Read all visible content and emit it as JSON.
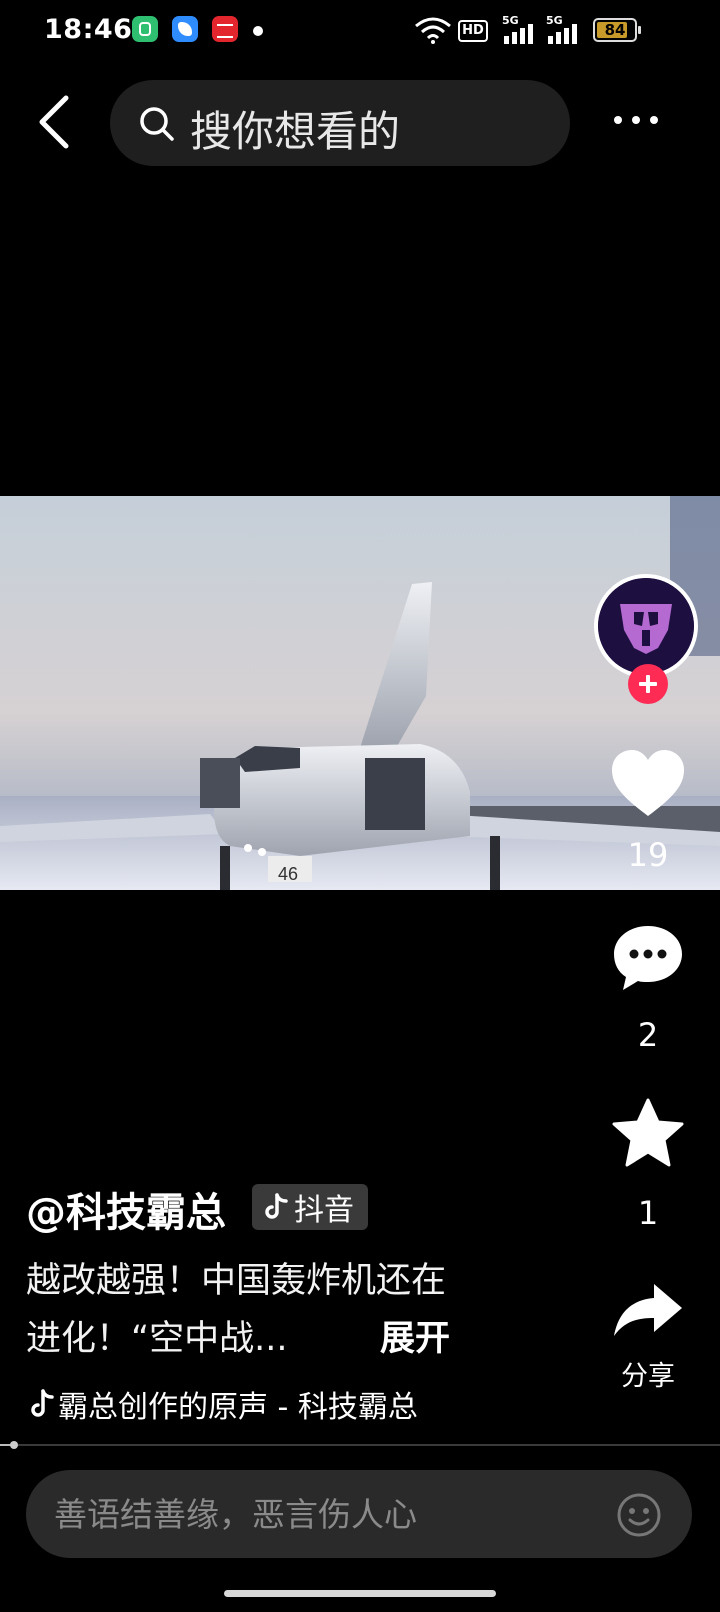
{
  "status_bar": {
    "time": "18:46",
    "battery": "84",
    "hd_label": "HD",
    "signal_1": "5G",
    "signal_2": "5G"
  },
  "header": {
    "search_placeholder": "搜你想看的"
  },
  "video": {
    "tail_number": "46"
  },
  "actions": {
    "likes": "19",
    "comments": "2",
    "favorites": "1",
    "share_label": "分享"
  },
  "caption": {
    "author": "@科技霸总",
    "platform": "抖音",
    "description": "越改越强！中国轰炸机还在进化！“空中战...",
    "expand_label": "展开",
    "music": "霸总创作的原声 - 科技霸总"
  },
  "playback": {
    "progress": 0.02
  },
  "comment_input": {
    "placeholder": "善语结善缘，恶言伤人心"
  },
  "colors": {
    "background": "#000000",
    "follow_accent": "#fe2c55",
    "input_bg": "#2a2a2a"
  }
}
